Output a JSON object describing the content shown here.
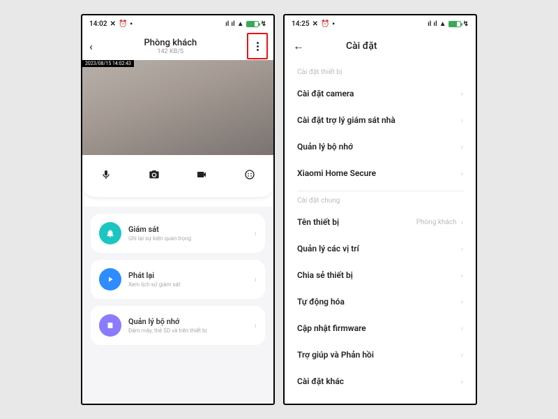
{
  "left": {
    "statusbar": {
      "time": "14:02",
      "battery": "82"
    },
    "title": "Phòng khách",
    "subtitle": "142 KB/S",
    "feed_timestamp": "2023/08/15 14:02:43",
    "cards": [
      {
        "title": "Giám sát",
        "sub": "Ghi lại sự kiện quan trọng"
      },
      {
        "title": "Phát lại",
        "sub": "Xem lịch sử giám sát"
      },
      {
        "title": "Quản lý bộ nhớ",
        "sub": "Đám mây, thẻ SD và trên thiết bị"
      }
    ]
  },
  "right": {
    "statusbar": {
      "time": "14:25",
      "battery": "80"
    },
    "title": "Cài đặt",
    "sections": {
      "device_header": "Cài đặt thiết bị",
      "device_items": [
        "Cài đặt camera",
        "Cài đặt trợ lý giám sát nhà",
        "Quản lý bộ nhớ",
        "Xiaomi Home Secure"
      ],
      "general_header": "Cài đặt chung",
      "general_items": [
        {
          "label": "Tên thiết bị",
          "value": "Phòng khách"
        },
        {
          "label": "Quản lý các vị trí"
        },
        {
          "label": "Chia sẻ thiết bị"
        },
        {
          "label": "Tự động hóa"
        },
        {
          "label": "Cập nhật firmware"
        },
        {
          "label": "Trợ giúp và Phản hồi"
        },
        {
          "label": "Cài đặt khác"
        }
      ]
    }
  }
}
